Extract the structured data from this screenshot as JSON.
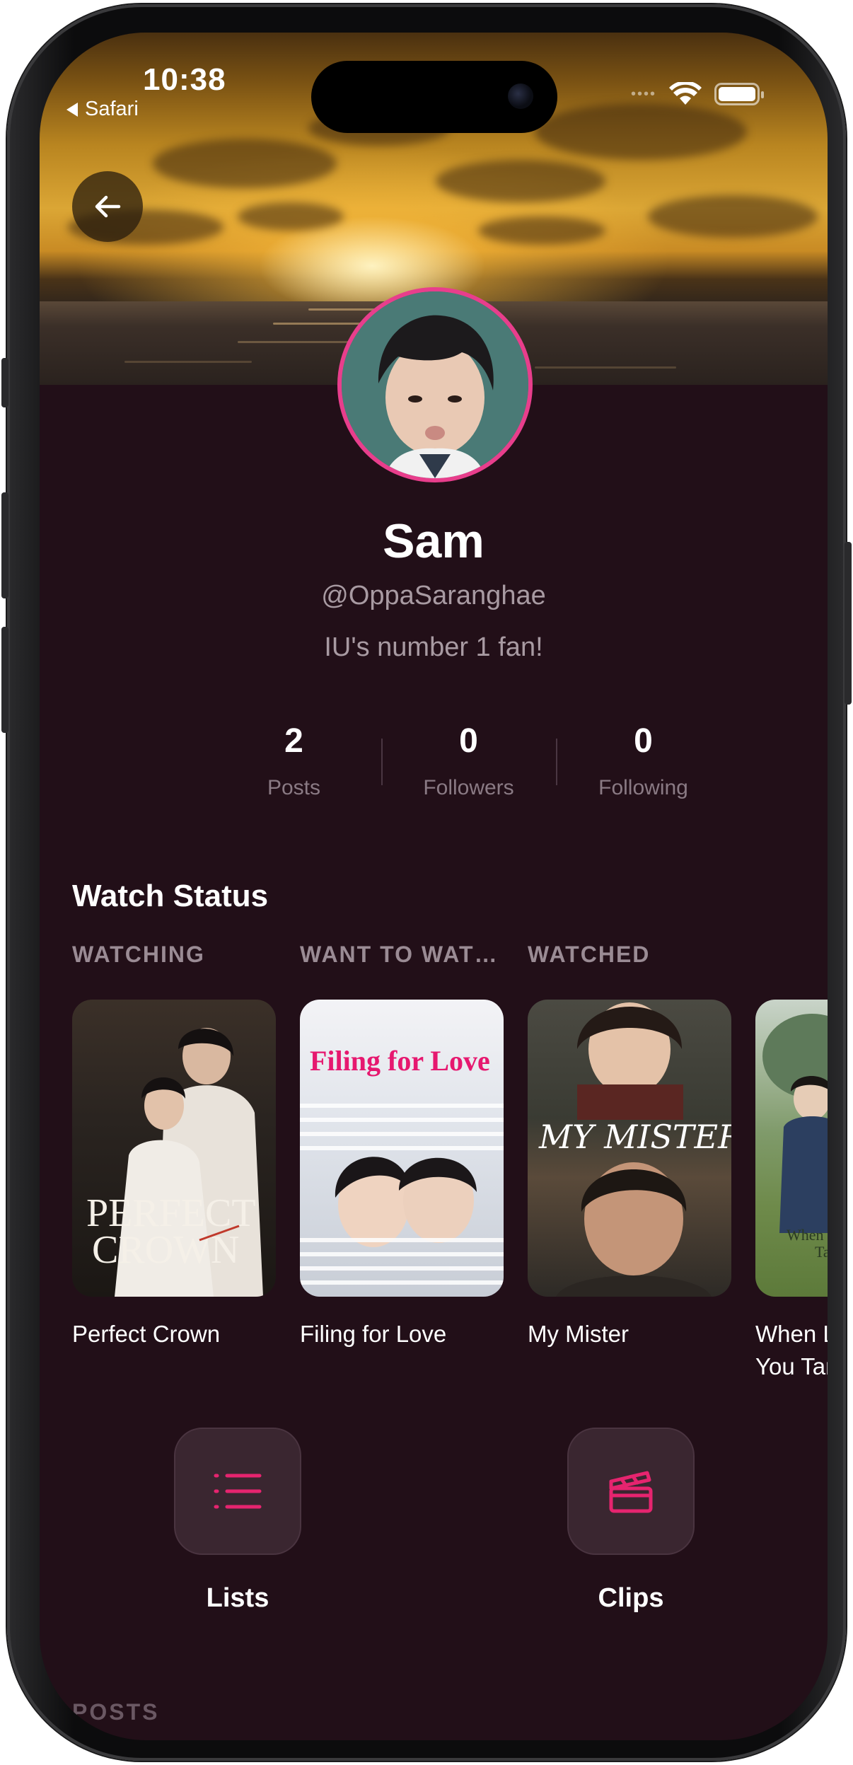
{
  "status_bar": {
    "time": "10:38",
    "back_app": "Safari"
  },
  "profile": {
    "name": "Sam",
    "handle": "@OppaSaranghae",
    "bio": "IU's number 1 fan!"
  },
  "stats": [
    {
      "value": "2",
      "label": "Posts"
    },
    {
      "value": "0",
      "label": "Followers"
    },
    {
      "value": "0",
      "label": "Following"
    }
  ],
  "watch_status": {
    "title": "Watch Status",
    "items": [
      {
        "category": "WATCHING",
        "title": "Perfect Crown",
        "poster_text": [
          "PERFECT",
          "CROWN"
        ]
      },
      {
        "category": "WANT TO WAT…",
        "title": "Filing for Love",
        "poster_text": [
          "Filing for Love"
        ]
      },
      {
        "category": "WATCHED",
        "title": "My Mister",
        "poster_text": [
          "MY MISTER"
        ]
      },
      {
        "category": "",
        "title": "When Life Gives You Tangerines",
        "title_lines": [
          "When L",
          "You Tar"
        ],
        "poster_text": [
          "When L",
          "Ta"
        ]
      }
    ]
  },
  "actions": {
    "lists_label": "Lists",
    "clips_label": "Clips"
  },
  "posts_section_label": "POSTS",
  "colors": {
    "background": "#220f18",
    "accent": "#e83e8c",
    "muted_text": "#a89aa2"
  }
}
